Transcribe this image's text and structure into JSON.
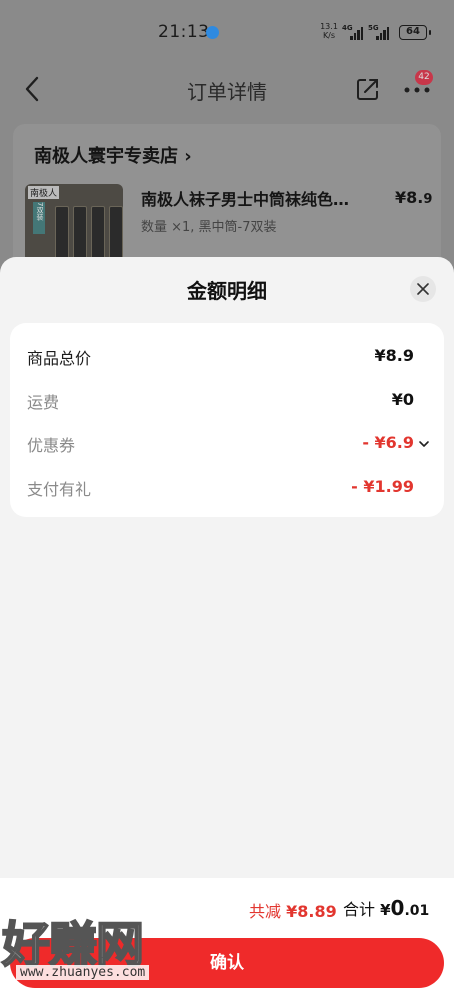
{
  "status_bar": {
    "time": "21:13",
    "net_speed_value": "13.1",
    "net_speed_unit": "K/s",
    "signal_1": "4G",
    "signal_2": "5G",
    "battery": "64"
  },
  "nav": {
    "title": "订单详情",
    "badge_count": "42",
    "icons": [
      "back-icon",
      "share-icon",
      "more-icon"
    ]
  },
  "shop": {
    "name": "南极人寰宇专卖店",
    "product_name": "南极人袜子男士中筒袜纯色…",
    "product_price_symbol": "¥",
    "product_price_int": "8.",
    "product_price_dec": "9",
    "product_spec": "数量 ×1, 黑中筒-7双装",
    "thumb_brand": "南极人",
    "thumb_tag": "7双装"
  },
  "sheet": {
    "title": "金额明细",
    "rows": [
      {
        "label": "商品总价",
        "value": "¥8.9"
      },
      {
        "label": "运费",
        "value": "¥0"
      },
      {
        "label": "优惠券",
        "value": "- ¥6.9"
      },
      {
        "label": "支付有礼",
        "value": "- ¥1.99"
      }
    ]
  },
  "footer": {
    "saved_label": "共减",
    "saved_value": "¥8.89",
    "total_label": "合计",
    "total_symbol": "¥",
    "total_int": "0",
    "total_dec": ".01",
    "confirm_label": "确认"
  },
  "watermark": {
    "brand": "好赚网",
    "url": "www.zhuanyes.com"
  },
  "colors": {
    "accent_red": "#ef2a2a",
    "discount_red": "#e2362f",
    "sheet_bg": "#f3f3f3",
    "card_bg": "#ffffff"
  }
}
